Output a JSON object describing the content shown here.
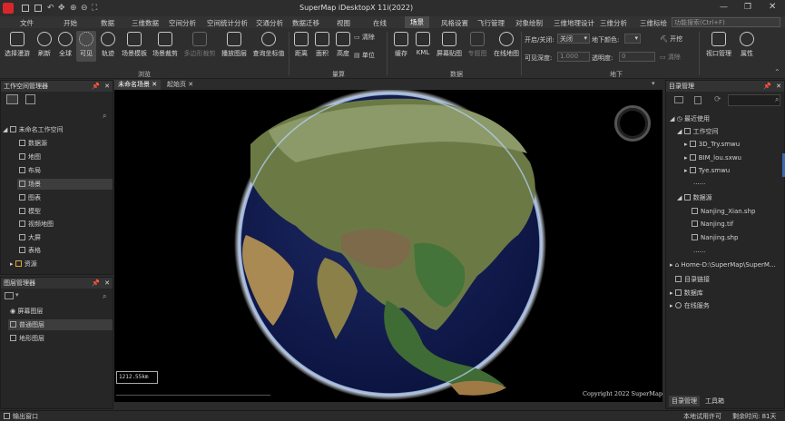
{
  "app": {
    "title": "SuperMap iDesktopX 11i(2022)",
    "search_placeholder": "功能搜索(Ctrl+F)"
  },
  "menu": [
    "文件",
    "开始",
    "数据",
    "三维数据",
    "空间分析",
    "空间统计分析",
    "交通分析",
    "数据迁移",
    "视图",
    "在线",
    "场景",
    "风格设置",
    "飞行管理",
    "对象绘制",
    "三维地理设计",
    "三维分析",
    "三维标绘"
  ],
  "ribbon": {
    "browse": {
      "items": [
        "选择漫游",
        "刷新",
        "全球",
        "可见",
        "轨迹",
        "场景模板",
        "场景裁剪",
        "多边形裁剪",
        "播放图层",
        "查询坐标值"
      ],
      "label": "浏览"
    },
    "measure": {
      "items": [
        "距离",
        "面积",
        "高度",
        "清除",
        "单位"
      ],
      "label": "量算"
    },
    "data": {
      "items": [
        "缓存",
        "KML",
        "屏幕贴图",
        "专题图",
        "在线地图"
      ],
      "label": "数据"
    },
    "underground": {
      "open_close_label": "开启/关闭:",
      "open_close_value": "关闭",
      "color_label": "地下颜色:",
      "depth_label": "可见深度:",
      "depth_value": "1.000",
      "transparency_label": "透明度:",
      "transparency_value": "0",
      "label": "地下"
    },
    "right": {
      "open": "开挖",
      "clear": "清除",
      "viewport": "视口管理",
      "properties": "属性"
    }
  },
  "workspace_panel": {
    "title": "工作空间管理器",
    "root": "未命名工作空间",
    "items": [
      "数据源",
      "地图",
      "布局",
      "场景",
      "图表",
      "模型",
      "视频地图",
      "大屏",
      "表格",
      "资源"
    ]
  },
  "layer_panel": {
    "title": "图层管理器",
    "items": [
      "屏幕图层",
      "普通图层",
      "地形图层"
    ]
  },
  "tabs": [
    "未命名场景",
    "起始页"
  ],
  "viewport": {
    "scale": "1212.55km",
    "copyright": "Copyright 2022 SuperMap"
  },
  "directory": {
    "title": "目录管理",
    "recent": "最近使用",
    "workspace": "工作空间",
    "files": [
      "3D_Try.smwu",
      "BIM_lou.sxwu",
      "Tye.smwu"
    ],
    "more": "......",
    "datasource": "数据源",
    "ds_files": [
      "Nanjing_Xian.shp",
      "Nanjing.tif",
      "Nanjing.shp"
    ],
    "home": "Home-D:\\SuperMap\\SuperM...",
    "dir_link": "目录链接",
    "database": "数据库",
    "online": "在线服务",
    "tabs": [
      "目录管理",
      "工具箱"
    ]
  },
  "status": {
    "output": "输出窗口",
    "license": "本地试用许可",
    "days": "剩余时间: 81天"
  }
}
